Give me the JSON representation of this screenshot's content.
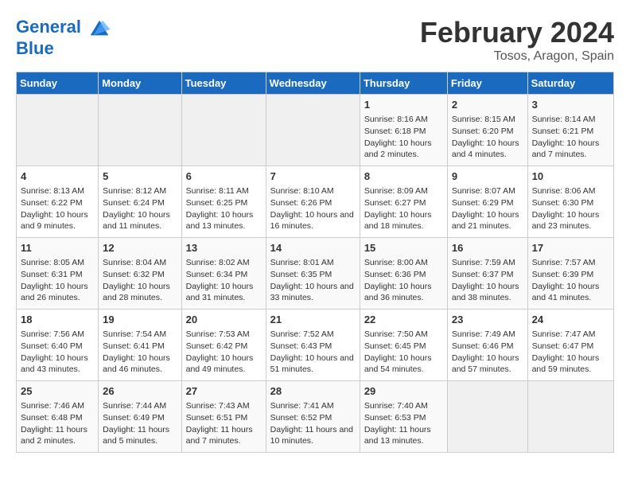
{
  "header": {
    "logo_line1": "General",
    "logo_line2": "Blue",
    "month": "February 2024",
    "location": "Tosos, Aragon, Spain"
  },
  "weekdays": [
    "Sunday",
    "Monday",
    "Tuesday",
    "Wednesday",
    "Thursday",
    "Friday",
    "Saturday"
  ],
  "weeks": [
    [
      {
        "day": "",
        "empty": true
      },
      {
        "day": "",
        "empty": true
      },
      {
        "day": "",
        "empty": true
      },
      {
        "day": "",
        "empty": true
      },
      {
        "day": "1",
        "sunrise": "8:16 AM",
        "sunset": "6:18 PM",
        "daylight": "10 hours and 2 minutes."
      },
      {
        "day": "2",
        "sunrise": "8:15 AM",
        "sunset": "6:20 PM",
        "daylight": "10 hours and 4 minutes."
      },
      {
        "day": "3",
        "sunrise": "8:14 AM",
        "sunset": "6:21 PM",
        "daylight": "10 hours and 7 minutes."
      }
    ],
    [
      {
        "day": "4",
        "sunrise": "8:13 AM",
        "sunset": "6:22 PM",
        "daylight": "10 hours and 9 minutes."
      },
      {
        "day": "5",
        "sunrise": "8:12 AM",
        "sunset": "6:24 PM",
        "daylight": "10 hours and 11 minutes."
      },
      {
        "day": "6",
        "sunrise": "8:11 AM",
        "sunset": "6:25 PM",
        "daylight": "10 hours and 13 minutes."
      },
      {
        "day": "7",
        "sunrise": "8:10 AM",
        "sunset": "6:26 PM",
        "daylight": "10 hours and 16 minutes."
      },
      {
        "day": "8",
        "sunrise": "8:09 AM",
        "sunset": "6:27 PM",
        "daylight": "10 hours and 18 minutes."
      },
      {
        "day": "9",
        "sunrise": "8:07 AM",
        "sunset": "6:29 PM",
        "daylight": "10 hours and 21 minutes."
      },
      {
        "day": "10",
        "sunrise": "8:06 AM",
        "sunset": "6:30 PM",
        "daylight": "10 hours and 23 minutes."
      }
    ],
    [
      {
        "day": "11",
        "sunrise": "8:05 AM",
        "sunset": "6:31 PM",
        "daylight": "10 hours and 26 minutes."
      },
      {
        "day": "12",
        "sunrise": "8:04 AM",
        "sunset": "6:32 PM",
        "daylight": "10 hours and 28 minutes."
      },
      {
        "day": "13",
        "sunrise": "8:02 AM",
        "sunset": "6:34 PM",
        "daylight": "10 hours and 31 minutes."
      },
      {
        "day": "14",
        "sunrise": "8:01 AM",
        "sunset": "6:35 PM",
        "daylight": "10 hours and 33 minutes."
      },
      {
        "day": "15",
        "sunrise": "8:00 AM",
        "sunset": "6:36 PM",
        "daylight": "10 hours and 36 minutes."
      },
      {
        "day": "16",
        "sunrise": "7:59 AM",
        "sunset": "6:37 PM",
        "daylight": "10 hours and 38 minutes."
      },
      {
        "day": "17",
        "sunrise": "7:57 AM",
        "sunset": "6:39 PM",
        "daylight": "10 hours and 41 minutes."
      }
    ],
    [
      {
        "day": "18",
        "sunrise": "7:56 AM",
        "sunset": "6:40 PM",
        "daylight": "10 hours and 43 minutes."
      },
      {
        "day": "19",
        "sunrise": "7:54 AM",
        "sunset": "6:41 PM",
        "daylight": "10 hours and 46 minutes."
      },
      {
        "day": "20",
        "sunrise": "7:53 AM",
        "sunset": "6:42 PM",
        "daylight": "10 hours and 49 minutes."
      },
      {
        "day": "21",
        "sunrise": "7:52 AM",
        "sunset": "6:43 PM",
        "daylight": "10 hours and 51 minutes."
      },
      {
        "day": "22",
        "sunrise": "7:50 AM",
        "sunset": "6:45 PM",
        "daylight": "10 hours and 54 minutes."
      },
      {
        "day": "23",
        "sunrise": "7:49 AM",
        "sunset": "6:46 PM",
        "daylight": "10 hours and 57 minutes."
      },
      {
        "day": "24",
        "sunrise": "7:47 AM",
        "sunset": "6:47 PM",
        "daylight": "10 hours and 59 minutes."
      }
    ],
    [
      {
        "day": "25",
        "sunrise": "7:46 AM",
        "sunset": "6:48 PM",
        "daylight": "11 hours and 2 minutes."
      },
      {
        "day": "26",
        "sunrise": "7:44 AM",
        "sunset": "6:49 PM",
        "daylight": "11 hours and 5 minutes."
      },
      {
        "day": "27",
        "sunrise": "7:43 AM",
        "sunset": "6:51 PM",
        "daylight": "11 hours and 7 minutes."
      },
      {
        "day": "28",
        "sunrise": "7:41 AM",
        "sunset": "6:52 PM",
        "daylight": "11 hours and 10 minutes."
      },
      {
        "day": "29",
        "sunrise": "7:40 AM",
        "sunset": "6:53 PM",
        "daylight": "11 hours and 13 minutes."
      },
      {
        "day": "",
        "empty": true
      },
      {
        "day": "",
        "empty": true
      }
    ]
  ]
}
